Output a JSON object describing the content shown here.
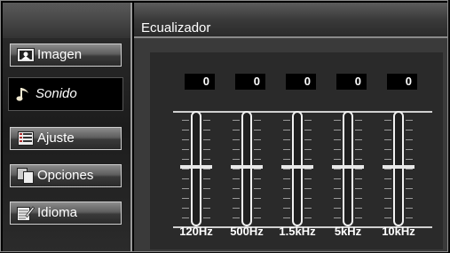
{
  "header": {
    "title": "Ecualizador"
  },
  "sidebar": {
    "items": [
      {
        "label": "Imagen",
        "icon": "picture-icon",
        "active": false
      },
      {
        "label": "Sonido",
        "icon": "music-note-icon",
        "active": true
      },
      {
        "label": "Ajuste",
        "icon": "settings-list-icon",
        "active": false
      },
      {
        "label": "Opciones",
        "icon": "copy-pages-icon",
        "active": false
      },
      {
        "label": "Idioma",
        "icon": "notepad-pencil-icon",
        "active": false
      }
    ]
  },
  "equalizer": {
    "bands": [
      {
        "freq": "120Hz",
        "value": "0"
      },
      {
        "freq": "500Hz",
        "value": "0"
      },
      {
        "freq": "1.5kHz",
        "value": "0"
      },
      {
        "freq": "5kHz",
        "value": "0"
      },
      {
        "freq": "10kHz",
        "value": "0"
      }
    ]
  },
  "colors": {
    "text": "#ffffff",
    "panel": "#3a3a3a",
    "slider": "#f2f2f2"
  }
}
